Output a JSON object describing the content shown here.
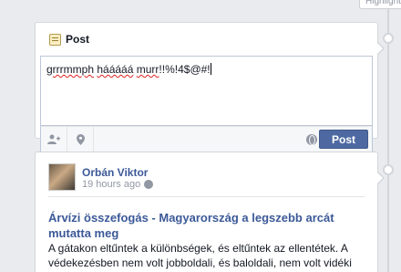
{
  "timeline": {
    "top_pill_label": "Highlights"
  },
  "composer": {
    "header_label": "Post",
    "input_text_words": [
      "grrrmmph",
      "hááááá",
      "murr",
      "!!%!4$@#!"
    ],
    "post_button_label": "Post",
    "icons": [
      "tag-friends-icon",
      "location-pin-icon",
      "audience-globe-icon"
    ]
  },
  "story": {
    "author_name": "Orbán Viktor",
    "timestamp": "19 hours ago",
    "link_title": "Árvízi összefogás - Magyarország a legszebb arcát mutatta meg",
    "link_description": "A gátakon eltűntek a különbségek, és eltűntek az ellentétek. A védekezésben nem volt jobboldali, és baloldali, nem volt vidéki és fővárosi, nem volt szegény és gazdag."
  },
  "colors": {
    "page_background": "#e9ebee",
    "link_blue": "#3b5998",
    "button_blue": "#4e69a2",
    "muted_text": "#9197a3"
  }
}
